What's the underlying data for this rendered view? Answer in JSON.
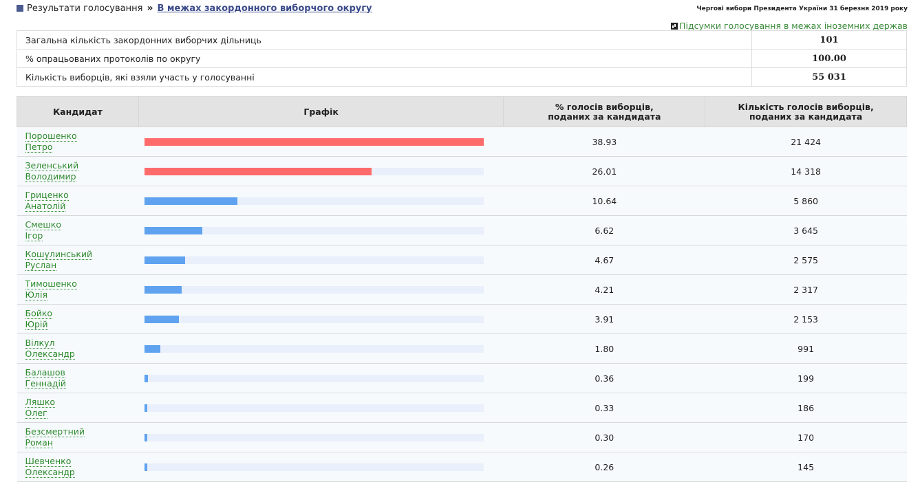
{
  "breadcrumb": {
    "root": "Результати голосування",
    "separator": "»",
    "current": "В межах закордонного виборчого округу"
  },
  "election_title": "Чергові вибори Президента України 31 березня 2019 року",
  "summary_link": "Підсумки голосування в межах іноземних держав",
  "stats": [
    {
      "label": "Загальна кількість закордонних виборчих дільниць",
      "value": "101"
    },
    {
      "label": "% опрацьованих протоколів по округу",
      "value": "100.00"
    },
    {
      "label": "Кількість виборців, які взяли участь у голосуванні",
      "value": "55 031"
    }
  ],
  "columns": {
    "candidate": "Кандидат",
    "graph": "Графік",
    "pct_line1": "% голосів виборців,",
    "pct_line2": "поданих за кандидата",
    "cnt_line1": "Кількість голосів виборців,",
    "cnt_line2": "поданих за кандидата"
  },
  "colors": {
    "leader": "#ff6a6a",
    "other": "#5ea2f0"
  },
  "candidates": [
    {
      "surname": "Порошенко",
      "name": "Петро",
      "pct": "38.93",
      "votes": "21 424",
      "share": 38.93,
      "leader": true
    },
    {
      "surname": "Зеленський",
      "name": "Володимир",
      "pct": "26.01",
      "votes": "14 318",
      "share": 26.01,
      "leader": true
    },
    {
      "surname": "Гриценко",
      "name": "Анатолій",
      "pct": "10.64",
      "votes": "5 860",
      "share": 10.64,
      "leader": false
    },
    {
      "surname": "Смешко",
      "name": "Ігор",
      "pct": "6.62",
      "votes": "3 645",
      "share": 6.62,
      "leader": false
    },
    {
      "surname": "Кошулинський",
      "name": "Руслан",
      "pct": "4.67",
      "votes": "2 575",
      "share": 4.67,
      "leader": false
    },
    {
      "surname": "Тимошенко",
      "name": "Юлія",
      "pct": "4.21",
      "votes": "2 317",
      "share": 4.21,
      "leader": false
    },
    {
      "surname": "Бойко",
      "name": "Юрій",
      "pct": "3.91",
      "votes": "2 153",
      "share": 3.91,
      "leader": false
    },
    {
      "surname": "Вілкул",
      "name": "Олександр",
      "pct": "1.80",
      "votes": "991",
      "share": 1.8,
      "leader": false
    },
    {
      "surname": "Балашов",
      "name": "Геннадій",
      "pct": "0.36",
      "votes": "199",
      "share": 0.36,
      "leader": false
    },
    {
      "surname": "Ляшко",
      "name": "Олег",
      "pct": "0.33",
      "votes": "186",
      "share": 0.33,
      "leader": false
    },
    {
      "surname": "Безсмертний",
      "name": "Роман",
      "pct": "0.30",
      "votes": "170",
      "share": 0.3,
      "leader": false
    },
    {
      "surname": "Шевченко",
      "name": "Олександр",
      "pct": "0.26",
      "votes": "145",
      "share": 0.26,
      "leader": false
    }
  ]
}
